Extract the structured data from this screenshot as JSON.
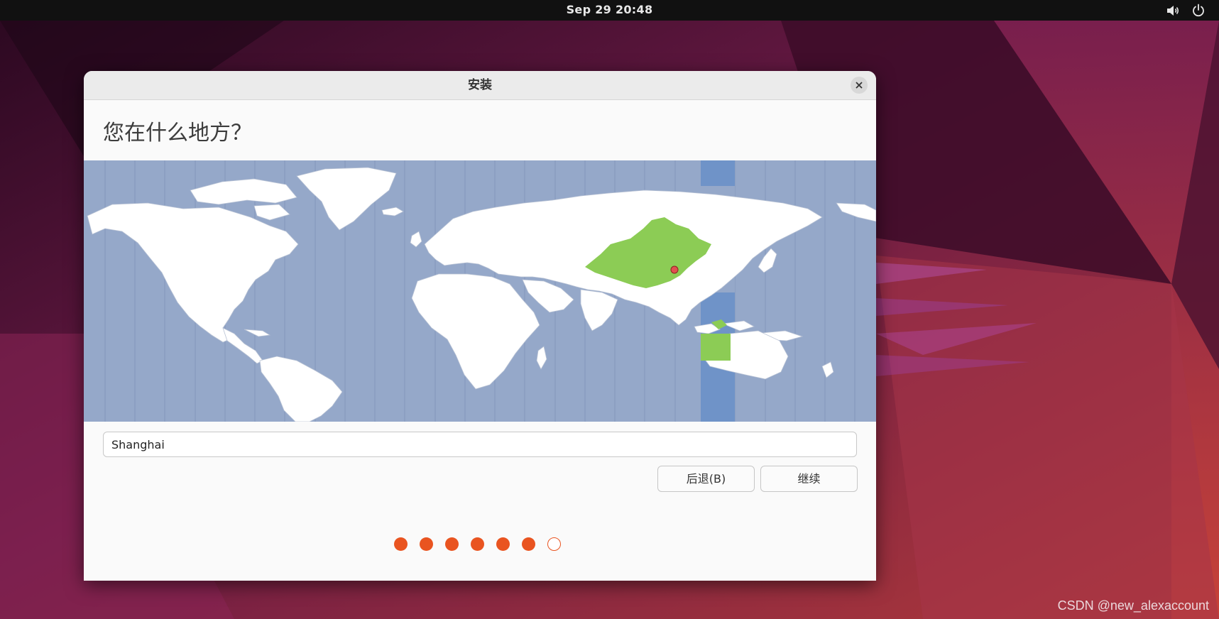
{
  "topbar": {
    "clock": "Sep 29  20:48",
    "icons": [
      "speaker-icon",
      "power-icon"
    ]
  },
  "window": {
    "title": "安装",
    "heading": "您在什么地方？",
    "timezone_input": {
      "value": "Shanghai"
    },
    "buttons": {
      "back": "后退(B)",
      "continue": "继续"
    },
    "progress": {
      "total_steps": 7,
      "completed_steps": 6,
      "current_step": 7
    },
    "map": {
      "selected_city": "Shanghai",
      "highlight_color": "#8ccc55",
      "ocean_color": "#95a8c9",
      "timezone_band_color": "#6f93c8",
      "marker_color": "#e05050"
    }
  },
  "watermark": "CSDN @new_alexaccount",
  "colors": {
    "accent": "#e95420",
    "topbar": "#111111"
  }
}
